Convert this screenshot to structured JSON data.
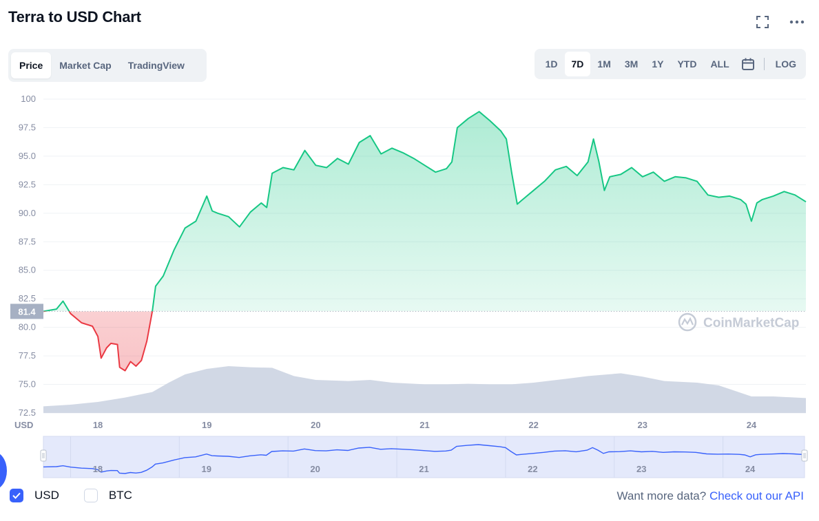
{
  "header": {
    "title": "Terra to USD Chart"
  },
  "tabs": [
    {
      "label": "Price",
      "active": true
    },
    {
      "label": "Market Cap",
      "active": false
    },
    {
      "label": "TradingView",
      "active": false
    }
  ],
  "ranges": [
    {
      "label": "1D",
      "active": false
    },
    {
      "label": "7D",
      "active": true
    },
    {
      "label": "1M",
      "active": false
    },
    {
      "label": "3M",
      "active": false
    },
    {
      "label": "1Y",
      "active": false
    },
    {
      "label": "YTD",
      "active": false
    },
    {
      "label": "ALL",
      "active": false
    }
  ],
  "log_label": "LOG",
  "icons": {
    "fullscreen": "fullscreen-icon",
    "more": "more-icon",
    "calendar": "calendar-icon"
  },
  "watermark": "CoinMarketCap",
  "legend": [
    {
      "label": "USD",
      "checked": true
    },
    {
      "label": "BTC",
      "checked": false
    }
  ],
  "api": {
    "prefix": "Want more data?",
    "link": "Check out our API"
  },
  "colors": {
    "up": "#16c784",
    "down": "#ea3943",
    "volume": "#cfd6e4",
    "accent": "#3861fb"
  },
  "chart_data": {
    "type": "line",
    "y_unit_label": "USD",
    "ylim": [
      72.5,
      100
    ],
    "yticks": [
      "100",
      "97.5",
      "95.0",
      "92.5",
      "90.0",
      "87.5",
      "85.0",
      "82.5",
      "80.0",
      "77.5",
      "75.0",
      "72.5"
    ],
    "xlim": [
      17.5,
      24.5
    ],
    "xticks": [
      "18",
      "19",
      "20",
      "21",
      "22",
      "23",
      "24"
    ],
    "baseline": 81.4,
    "baseline_label": "81.4",
    "grid": true,
    "series": [
      {
        "x": [
          17.5,
          17.62,
          17.68,
          17.75,
          17.85,
          17.95,
          18.0,
          18.03,
          18.08,
          18.12,
          18.18,
          18.2,
          18.25,
          18.3,
          18.35,
          18.4,
          18.45,
          18.5,
          18.53,
          18.6,
          18.7,
          18.8,
          18.9,
          19.0,
          19.05,
          19.1,
          19.2,
          19.3,
          19.4,
          19.5,
          19.55,
          19.6,
          19.7,
          19.8,
          19.9,
          20.0,
          20.1,
          20.2,
          20.3,
          20.4,
          20.5,
          20.6,
          20.7,
          20.8,
          20.9,
          21.0,
          21.1,
          21.2,
          21.25,
          21.3,
          21.4,
          21.5,
          21.6,
          21.7,
          21.75,
          21.8,
          21.85,
          21.9,
          22.0,
          22.1,
          22.2,
          22.3,
          22.4,
          22.5,
          22.55,
          22.6,
          22.65,
          22.7,
          22.8,
          22.9,
          23.0,
          23.1,
          23.2,
          23.3,
          23.4,
          23.5,
          23.6,
          23.7,
          23.8,
          23.9,
          23.95,
          24.0,
          24.05,
          24.1,
          24.2,
          24.3,
          24.4,
          24.5
        ],
        "y": [
          81.4,
          81.6,
          82.3,
          81.2,
          80.4,
          80.1,
          79.2,
          77.3,
          78.2,
          78.6,
          78.5,
          76.5,
          76.2,
          77.0,
          76.6,
          77.1,
          78.8,
          81.4,
          83.6,
          84.5,
          86.8,
          88.7,
          89.3,
          91.5,
          90.2,
          90.0,
          89.7,
          88.8,
          90.1,
          90.9,
          90.5,
          93.5,
          94.0,
          93.8,
          95.5,
          94.2,
          94.0,
          94.8,
          94.3,
          96.2,
          96.8,
          95.2,
          95.7,
          95.3,
          94.8,
          94.2,
          93.6,
          93.9,
          94.5,
          97.5,
          98.3,
          98.9,
          98.1,
          97.2,
          96.5,
          93.5,
          90.8,
          91.2,
          92.0,
          92.8,
          93.8,
          94.1,
          93.3,
          94.5,
          96.5,
          94.5,
          92.0,
          93.2,
          93.4,
          94.0,
          93.2,
          93.6,
          92.8,
          93.2,
          93.1,
          92.8,
          91.6,
          91.4,
          91.5,
          91.2,
          90.8,
          89.3,
          90.9,
          91.2,
          91.5,
          91.9,
          91.6,
          91.0
        ]
      }
    ],
    "volume": {
      "x": [
        17.5,
        17.75,
        18.0,
        18.25,
        18.5,
        18.65,
        18.8,
        19.0,
        19.2,
        19.4,
        19.6,
        19.8,
        20.0,
        20.3,
        20.5,
        20.7,
        21.0,
        21.2,
        21.4,
        21.6,
        21.8,
        22.0,
        22.3,
        22.5,
        22.8,
        23.0,
        23.2,
        23.5,
        23.7,
        24.0,
        24.2,
        24.5
      ],
      "y": [
        0.12,
        0.15,
        0.2,
        0.28,
        0.38,
        0.55,
        0.7,
        0.8,
        0.85,
        0.83,
        0.82,
        0.67,
        0.6,
        0.58,
        0.6,
        0.55,
        0.52,
        0.52,
        0.53,
        0.52,
        0.52,
        0.55,
        0.62,
        0.67,
        0.72,
        0.66,
        0.58,
        0.55,
        0.5,
        0.3,
        0.3,
        0.27
      ]
    }
  },
  "navigator": {
    "xticks": [
      "18",
      "19",
      "20",
      "21",
      "22",
      "23",
      "24"
    ]
  }
}
